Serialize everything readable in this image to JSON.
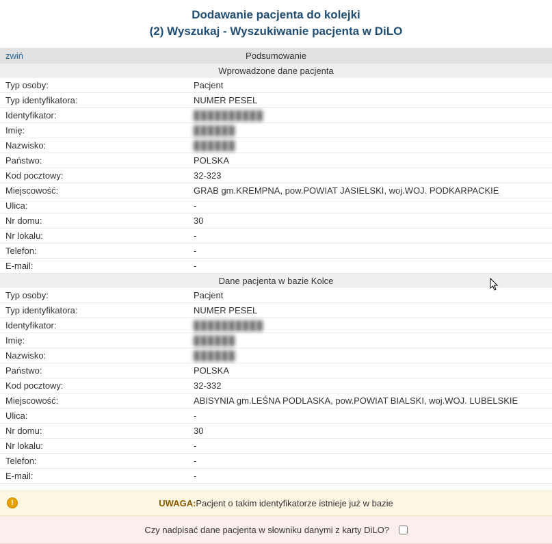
{
  "title_line1": "Dodawanie pacjenta do kolejki",
  "title_line2": "(2) Wyszukaj - Wyszukiwanie pacjenta w DiLO",
  "summary_header": "Podsumowanie",
  "collapse_label": "zwiń",
  "section_entered_header": "Wprowadzone dane pacjenta",
  "section_kolce_header": "Dane pacjenta w bazie Kolce",
  "labels": {
    "typ_osoby": "Typ osoby:",
    "typ_ident": "Typ identyfikatora:",
    "ident": "Identyfikator:",
    "imie": "Imię:",
    "nazwisko": "Nazwisko:",
    "panstwo": "Państwo:",
    "kod": "Kod pocztowy:",
    "miejscowosc": "Miejscowość:",
    "ulica": "Ulica:",
    "nr_domu": "Nr domu:",
    "nr_lokalu": "Nr lokalu:",
    "telefon": "Telefon:",
    "email": "E-mail:"
  },
  "entered": {
    "typ_osoby": "Pacjent",
    "typ_ident": "NUMER PESEL",
    "ident": "██████████",
    "imie": "██████",
    "nazwisko": "██████",
    "panstwo": "POLSKA",
    "kod": "32-323",
    "miejscowosc": "GRAB gm.KREMPNA, pow.POWIAT JASIELSKI, woj.WOJ. PODKARPACKIE",
    "ulica": "-",
    "nr_domu": "30",
    "nr_lokalu": "-",
    "telefon": "-",
    "email": "-"
  },
  "kolce": {
    "typ_osoby": "Pacjent",
    "typ_ident": "NUMER PESEL",
    "ident": "██████████",
    "imie": "██████",
    "nazwisko": "██████",
    "panstwo": "POLSKA",
    "kod": "32-332",
    "miejscowosc": "ABISYNIA gm.LEŚNA PODLASKA, pow.POWIAT BIALSKI, woj.WOJ. LUBELSKIE",
    "ulica": "-",
    "nr_domu": "30",
    "nr_lokalu": "-",
    "telefon": "-",
    "email": "-"
  },
  "alert_prefix": "UWAGA:",
  "alert_text": "Pacjent o takim identyfikatorze istnieje już w bazie",
  "overwrite_question": "Czy nadpisać dane pacjenta w słowniku danymi z karty DiLO?"
}
